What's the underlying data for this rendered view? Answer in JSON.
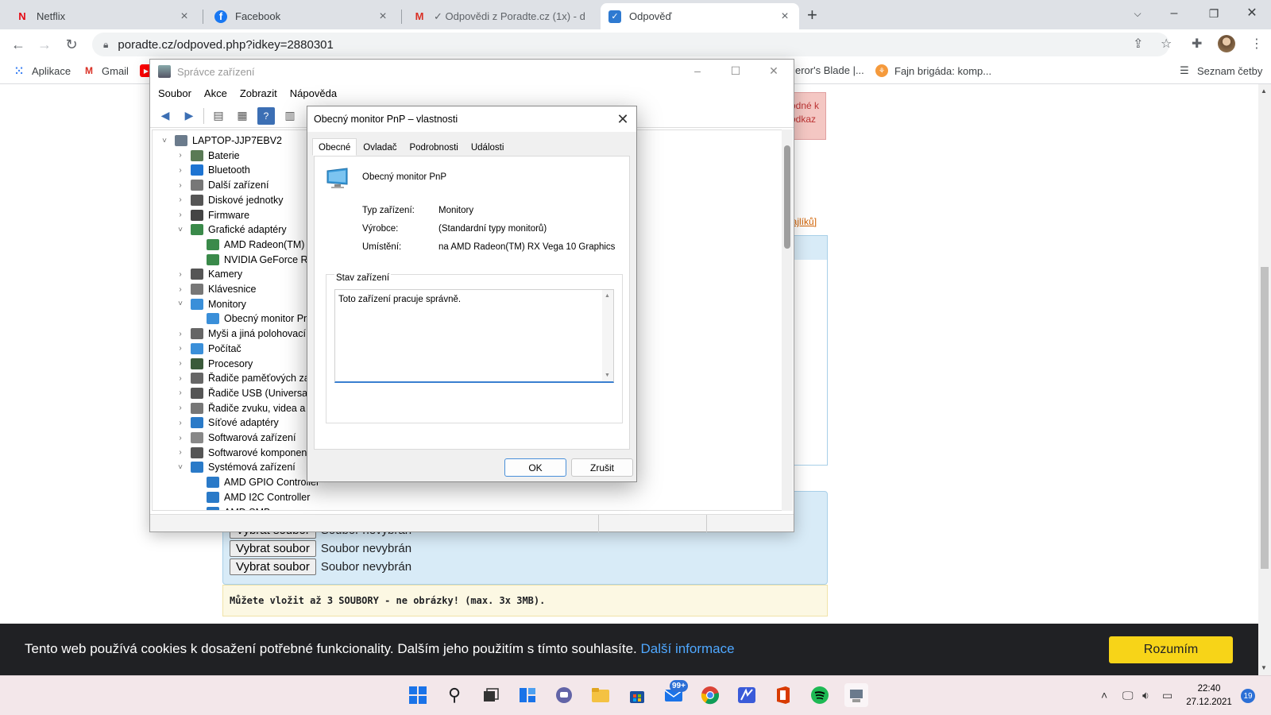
{
  "browser": {
    "tabs": [
      {
        "title": "Netflix",
        "icon": "netflix-icon",
        "active": false
      },
      {
        "title": "Facebook",
        "icon": "facebook-icon",
        "active": false
      },
      {
        "title": "✓ Odpovědi z Poradte.cz (1x) - d",
        "icon": "gmail-icon",
        "active": false
      },
      {
        "title": "Odpověď",
        "icon": "checkbox-icon",
        "active": true
      }
    ],
    "url": "poradte.cz/odpoved.php?idkey=2880301",
    "bookmarks": {
      "apps": "Aplikace",
      "gmail": "Gmail",
      "blade": "eror's Blade |...",
      "brigada": "Fajn brigáda: komp...",
      "reading_list": "Seznam četby"
    }
  },
  "page": {
    "red_box_text": "odné k\nodkaz",
    "orange_link": "najlíků]",
    "file_rows": [
      {
        "button": "Vybrat soubor",
        "status": "Soubor nevybrán"
      },
      {
        "button": "Vybrat soubor",
        "status": "Soubor nevybrán"
      },
      {
        "button": "Vybrat soubor",
        "status": "Soubor nevybrán"
      }
    ],
    "note": "Můžete vložit až 3 SOUBORY - ne obrázky! (max. 3x 3MB).",
    "cookie": {
      "text": "Tento web používá cookies k dosažení potřebné funkcionality. Dalším jeho použitím s tímto souhlasíte.",
      "link": "Další informace",
      "button": "Rozumím"
    }
  },
  "devmgr": {
    "title": "Správce zařízení",
    "menu": [
      "Soubor",
      "Akce",
      "Zobrazit",
      "Nápověda"
    ],
    "tree": [
      {
        "label": "LAPTOP-JJP7EBV2",
        "level": 0,
        "exp": "˅",
        "icon_color": "#6b7b8c"
      },
      {
        "label": "Baterie",
        "level": 1,
        "exp": "›",
        "icon_color": "#5a7a55"
      },
      {
        "label": "Bluetooth",
        "level": 1,
        "exp": "›",
        "icon_color": "#1e74d2"
      },
      {
        "label": "Další zařízení",
        "level": 1,
        "exp": "›",
        "icon_color": "#777"
      },
      {
        "label": "Diskové jednotky",
        "level": 1,
        "exp": "›",
        "icon_color": "#555"
      },
      {
        "label": "Firmware",
        "level": 1,
        "exp": "›",
        "icon_color": "#444"
      },
      {
        "label": "Grafické adaptéry",
        "level": 1,
        "exp": "˅",
        "icon_color": "#3a8a4a"
      },
      {
        "label": "AMD Radeon(TM) RX",
        "level": 2,
        "exp": "",
        "icon_color": "#3a8a4a"
      },
      {
        "label": "NVIDIA GeForce RTX",
        "level": 2,
        "exp": "",
        "icon_color": "#3a8a4a"
      },
      {
        "label": "Kamery",
        "level": 1,
        "exp": "›",
        "icon_color": "#555"
      },
      {
        "label": "Klávesnice",
        "level": 1,
        "exp": "›",
        "icon_color": "#777"
      },
      {
        "label": "Monitory",
        "level": 1,
        "exp": "˅",
        "icon_color": "#3a8fd9"
      },
      {
        "label": "Obecný monitor PnP",
        "level": 2,
        "exp": "",
        "icon_color": "#3a8fd9"
      },
      {
        "label": "Myši a jiná polohovací z",
        "level": 1,
        "exp": "›",
        "icon_color": "#666"
      },
      {
        "label": "Počítač",
        "level": 1,
        "exp": "›",
        "icon_color": "#3a8fd9"
      },
      {
        "label": "Procesory",
        "level": 1,
        "exp": "›",
        "icon_color": "#3a5a3a"
      },
      {
        "label": "Řadiče paměťových zaříz",
        "level": 1,
        "exp": "›",
        "icon_color": "#666"
      },
      {
        "label": "Řadiče USB (Universal Se",
        "level": 1,
        "exp": "›",
        "icon_color": "#555"
      },
      {
        "label": "Řadiče zvuku, videa a he",
        "level": 1,
        "exp": "›",
        "icon_color": "#777"
      },
      {
        "label": "Síťové adaptéry",
        "level": 1,
        "exp": "›",
        "icon_color": "#2a7ac8"
      },
      {
        "label": "Softwarová zařízení",
        "level": 1,
        "exp": "›",
        "icon_color": "#888"
      },
      {
        "label": "Softwarové komponenty",
        "level": 1,
        "exp": "›",
        "icon_color": "#555"
      },
      {
        "label": "Systémová zařízení",
        "level": 1,
        "exp": "˅",
        "icon_color": "#2a7ac8"
      },
      {
        "label": "AMD GPIO Controller",
        "level": 2,
        "exp": "",
        "icon_color": "#2a7ac8"
      },
      {
        "label": "AMD I2C Controller",
        "level": 2,
        "exp": "",
        "icon_color": "#2a7ac8"
      },
      {
        "label": "AMD SMBus",
        "level": 2,
        "exp": "",
        "icon_color": "#2a7ac8"
      }
    ]
  },
  "dialog": {
    "title": "Obecný monitor PnP – vlastnosti",
    "tabs": [
      "Obecné",
      "Ovladač",
      "Podrobnosti",
      "Události"
    ],
    "device_name": "Obecný monitor PnP",
    "props": [
      {
        "label": "Typ zařízení:",
        "value": "Monitory"
      },
      {
        "label": "Výrobce:",
        "value": "(Standardní typy monitorů)"
      },
      {
        "label": "Umístění:",
        "value": "na AMD Radeon(TM) RX Vega 10 Graphics"
      }
    ],
    "status_legend": "Stav zařízení",
    "status_text": "Toto zařízení pracuje správně.",
    "ok": "OK",
    "cancel": "Zrušit"
  },
  "taskbar": {
    "mail_badge": "99+",
    "time": "22:40",
    "date": "27.12.2021",
    "notifications": "19"
  }
}
